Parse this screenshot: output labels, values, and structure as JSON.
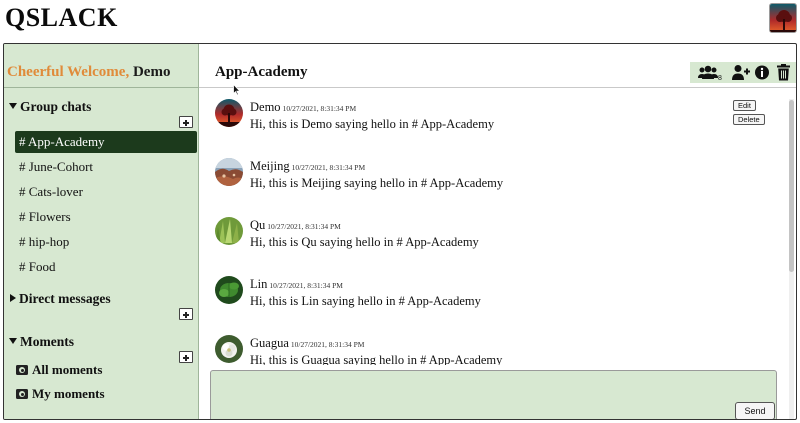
{
  "app": {
    "title": "QSLACK"
  },
  "sidebar": {
    "welcome_prefix": "Cheerful Welcome,",
    "welcome_name": "Demo",
    "group_chats_label": "Group chats",
    "channels": [
      {
        "label": "# App-Academy",
        "active": true
      },
      {
        "label": "# June-Cohort",
        "active": false
      },
      {
        "label": "# Cats-lover",
        "active": false
      },
      {
        "label": "# Flowers",
        "active": false
      },
      {
        "label": "# hip-hop",
        "active": false
      },
      {
        "label": "# Food",
        "active": false
      }
    ],
    "direct_messages_label": "Direct messages",
    "moments_label": "Moments",
    "moments": [
      {
        "label": "All moments",
        "icon": "camera-icon"
      },
      {
        "label": "My moments",
        "icon": "camera-icon"
      }
    ]
  },
  "main": {
    "channel_title": "App-Academy",
    "toolbar": {
      "member_count": "8",
      "icons": [
        "users-icon",
        "add-user-icon",
        "info-icon",
        "trash-icon"
      ]
    },
    "messages": [
      {
        "user": "Demo",
        "timestamp": "10/27/2021, 8:31:34 PM",
        "text": "Hi, this is Demo saying hello in # App-Academy"
      },
      {
        "user": "Meijing",
        "timestamp": "10/27/2021, 8:31:34 PM",
        "text": "Hi, this is Meijing saying hello in # App-Academy"
      },
      {
        "user": "Qu",
        "timestamp": "10/27/2021, 8:31:34 PM",
        "text": "Hi, this is Qu saying hello in # App-Academy"
      },
      {
        "user": "Lin",
        "timestamp": "10/27/2021, 8:31:34 PM",
        "text": "Hi, this is Lin saying hello in # App-Academy"
      },
      {
        "user": "Guagua",
        "timestamp": "10/27/2021, 8:31:34 PM",
        "text": "Hi, this is Guagua saying hello in # App-Academy"
      }
    ],
    "edit_label": "Edit",
    "delete_label": "Delete",
    "send_label": "Send"
  },
  "colors": {
    "sidebar_bg": "#d7e8d1",
    "active_channel_bg": "#1c3a1c",
    "welcome_accent": "#e08b3a"
  }
}
